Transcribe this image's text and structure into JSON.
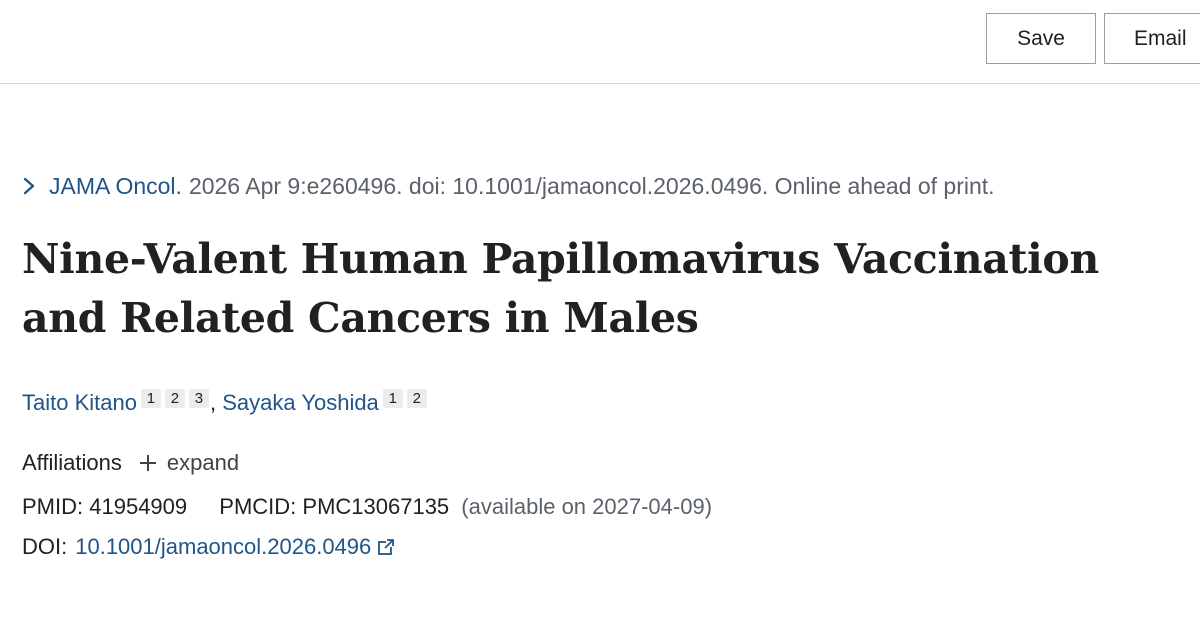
{
  "toolbar": {
    "save_label": "Save",
    "email_label": "Email"
  },
  "citation": {
    "journal": "JAMA Oncol.",
    "details": "2026 Apr 9:e260496. doi: 10.1001/jamaoncol.2026.0496. Online ahead of print."
  },
  "article": {
    "title": "Nine-Valent Human Papillomavirus Vaccination and Related Cancers in Males"
  },
  "authors": [
    {
      "name": "Taito Kitano",
      "affiliations": [
        "1",
        "2",
        "3"
      ]
    },
    {
      "name": "Sayaka Yoshida",
      "affiliations": [
        "1",
        "2"
      ]
    }
  ],
  "author_separator": ",",
  "affiliations": {
    "label": "Affiliations",
    "expand_label": "expand"
  },
  "identifiers": {
    "pmid_label": "PMID:",
    "pmid": "41954909",
    "pmcid_label": "PMCID:",
    "pmcid": "PMC13067135",
    "pmcid_note": "(available on 2027-04-09)",
    "doi_label": "DOI:",
    "doi": "10.1001/jamaoncol.2026.0496"
  },
  "icons": {
    "citation": "chevron-right-icon",
    "expand": "plus-icon",
    "doi": "external-link-icon"
  },
  "colors": {
    "link": "#20558a",
    "text": "#212121",
    "muted": "#5b616b",
    "badge_bg": "#ececec"
  }
}
